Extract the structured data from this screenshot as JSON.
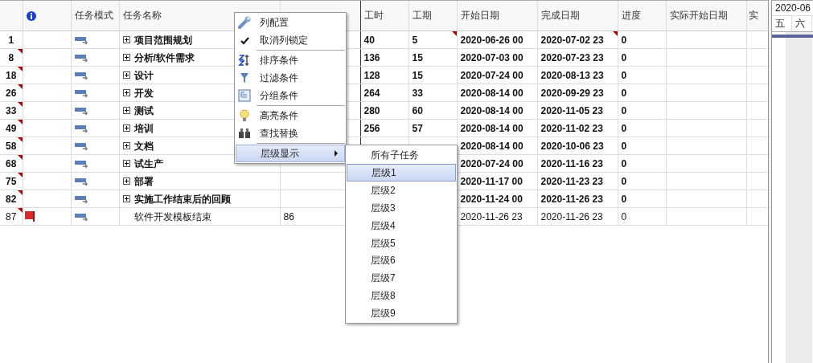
{
  "table": {
    "headers": [
      "任务模式",
      "任务名称",
      "工时",
      "工期",
      "开始日期",
      "完成日期",
      "进度",
      "实际开始日期",
      "实"
    ],
    "rows": [
      {
        "id": "1",
        "id_marked": false,
        "flagged": false,
        "summary": true,
        "name": "项目范围规划",
        "work": "40",
        "duration": "5",
        "duration_marked": true,
        "start": "2020-06-26 00",
        "finish": "2020-07-02 23",
        "finish_marked": true,
        "progress": "0"
      },
      {
        "id": "8",
        "id_marked": true,
        "flagged": false,
        "summary": true,
        "name": "分析/软件需求",
        "work": "136",
        "duration": "15",
        "duration_marked": false,
        "start": "2020-07-03 00",
        "finish": "2020-07-23 23",
        "finish_marked": false,
        "progress": "0"
      },
      {
        "id": "18",
        "id_marked": true,
        "flagged": false,
        "summary": true,
        "name": "设计",
        "work": "128",
        "duration": "15",
        "duration_marked": false,
        "start": "2020-07-24 00",
        "finish": "2020-08-13 23",
        "finish_marked": false,
        "progress": "0"
      },
      {
        "id": "26",
        "id_marked": true,
        "flagged": false,
        "summary": true,
        "name": "开发",
        "work": "264",
        "duration": "33",
        "duration_marked": false,
        "start": "2020-08-14 00",
        "finish": "2020-09-29 23",
        "finish_marked": false,
        "progress": "0"
      },
      {
        "id": "33",
        "id_marked": true,
        "flagged": false,
        "summary": true,
        "name": "测试",
        "work": "280",
        "duration": "60",
        "duration_marked": false,
        "start": "2020-08-14 00",
        "finish": "2020-11-05 23",
        "finish_marked": false,
        "progress": "0"
      },
      {
        "id": "49",
        "id_marked": true,
        "flagged": false,
        "summary": true,
        "name": "培训",
        "work": "256",
        "duration": "57",
        "duration_marked": false,
        "start": "2020-08-14 00",
        "finish": "2020-11-02 23",
        "finish_marked": false,
        "progress": "0"
      },
      {
        "id": "58",
        "id_marked": true,
        "flagged": false,
        "summary": true,
        "name": "文档",
        "duration_marked": false,
        "start": "2020-08-14 00",
        "finish": "2020-10-06 23",
        "finish_marked": false,
        "progress": "0"
      },
      {
        "id": "68",
        "id_marked": true,
        "flagged": false,
        "summary": true,
        "name": "试生产",
        "duration_marked": false,
        "start": "2020-07-24 00",
        "finish": "2020-11-16 23",
        "finish_marked": false,
        "progress": "0"
      },
      {
        "id": "75",
        "id_marked": true,
        "flagged": false,
        "summary": true,
        "name": "部署",
        "duration_marked": false,
        "start": "2020-11-17 00",
        "finish": "2020-11-23 23",
        "finish_marked": false,
        "progress": "0"
      },
      {
        "id": "82",
        "id_marked": true,
        "flagged": false,
        "summary": true,
        "name": "实施工作结束后的回顾",
        "duration_marked": false,
        "start": "2020-11-24 00",
        "finish": "2020-11-26 23",
        "finish_marked": false,
        "progress": "0"
      },
      {
        "id": "87",
        "id_marked": true,
        "flagged": true,
        "summary": false,
        "name": "软件开发模板结束",
        "column_5": "86",
        "duration_marked": false,
        "start": "2020-11-26 23",
        "finish": "2020-11-26 23",
        "finish_marked": false,
        "progress": "0"
      }
    ]
  },
  "gantt": {
    "month": "2020-06",
    "days": [
      {
        "label": "五",
        "weekend": false
      },
      {
        "label": "六",
        "weekend": true
      }
    ]
  },
  "context_menu": {
    "items": [
      {
        "label": "列配置",
        "separator_after": false,
        "selected": false,
        "has_submenu": false
      },
      {
        "label": "取消列锁定",
        "checked": true,
        "separator_after": true,
        "selected": false,
        "has_submenu": false
      },
      {
        "label": "排序条件",
        "separator_after": false,
        "selected": false,
        "has_submenu": false
      },
      {
        "label": "过滤条件",
        "separator_after": false,
        "selected": false,
        "has_submenu": false
      },
      {
        "label": "分组条件",
        "separator_after": true,
        "selected": false,
        "has_submenu": false
      },
      {
        "label": "高亮条件",
        "separator_after": false,
        "selected": false,
        "has_submenu": false
      },
      {
        "label": "查找替换",
        "separator_after": true,
        "selected": false,
        "has_submenu": false
      },
      {
        "label": "层级显示",
        "separator_after": false,
        "selected": true,
        "has_submenu": true
      }
    ]
  },
  "submenu": {
    "items": [
      {
        "label": "所有子任务",
        "selected": false
      },
      {
        "label": "层级1",
        "selected": true
      },
      {
        "label": "层级2",
        "selected": false
      },
      {
        "label": "层级3",
        "selected": false
      },
      {
        "label": "层级4",
        "selected": false
      },
      {
        "label": "层级5",
        "selected": false
      },
      {
        "label": "层级6",
        "selected": false
      },
      {
        "label": "层级7",
        "selected": false
      },
      {
        "label": "层级8",
        "selected": false
      },
      {
        "label": "层级9",
        "selected": false
      }
    ]
  }
}
